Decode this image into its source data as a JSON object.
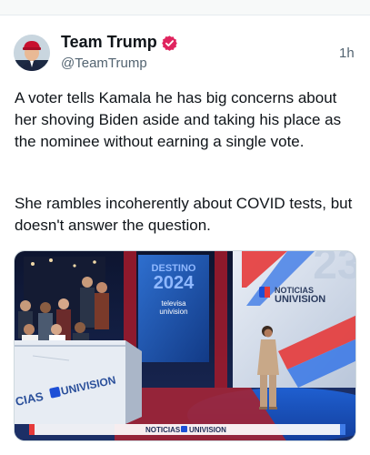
{
  "post": {
    "author": {
      "name": "Team Trump",
      "handle": "@TeamTrump",
      "verified_color": "#e0245e"
    },
    "timestamp": "1h",
    "paragraphs": [
      "A voter tells Kamala he has big concerns about her shoving Biden aside and taking his place as the nominee without earning a single vote.",
      "She rambles incoherently about COVID tests, but doesn't answer the question."
    ],
    "media": {
      "type": "video-frame",
      "overlay_texts": {
        "stage_screen_brand": "Noticias Univision",
        "stage_screen_show": "Destino 2024",
        "stage_screen_partner": "Televisa Univision",
        "desk_brand": "CIAS UNIVISION",
        "chyron_brand": "NOTICIAS UNIVISION"
      }
    }
  }
}
